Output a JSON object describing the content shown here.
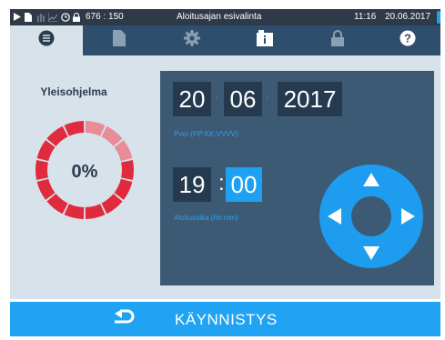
{
  "status_bar": {
    "counter": "676 : 150",
    "title": "Aloitusajan esivalinta",
    "time": "11:16",
    "date": "20.06.2017",
    "icons": [
      "play-icon",
      "document-icon",
      "steam-icon",
      "graph-icon",
      "clock-icon",
      "lock-icon"
    ]
  },
  "tabs": [
    {
      "icon": "menu-icon",
      "active": true
    },
    {
      "icon": "document-icon",
      "active": false
    },
    {
      "icon": "gear-icon",
      "active": false
    },
    {
      "icon": "info-icon",
      "active": false
    },
    {
      "icon": "lock-icon",
      "active": false
    },
    {
      "icon": "help-icon",
      "active": false
    }
  ],
  "program": {
    "name": "Yleisohjelma",
    "progress_label": "0%",
    "progress_fraction": 0,
    "ring_segments": 14
  },
  "date_entry": {
    "day": "20",
    "month": "06",
    "year": "2017",
    "hint": "Pvm (PP:KK:VVVV)"
  },
  "time_entry": {
    "hours": "19",
    "minutes": "00",
    "hint": "Aloitusaika (hh:mm)",
    "selected_field": "minutes"
  },
  "dpad": {
    "buttons": [
      "up",
      "down",
      "left",
      "right"
    ]
  },
  "bottom_bar": {
    "start_label": "KÄYNNISTYS",
    "back_icon": "back-arrow-icon"
  },
  "colors": {
    "status_bar": "#2e3a47",
    "tab_bar": "#2f4e6e",
    "main_bg": "#d7e2ea",
    "panel": "#3c5a74",
    "field": "#253a4e",
    "accent": "#1fa3f2",
    "ring_primary": "#e02a3e",
    "ring_light": "#e88c98"
  }
}
